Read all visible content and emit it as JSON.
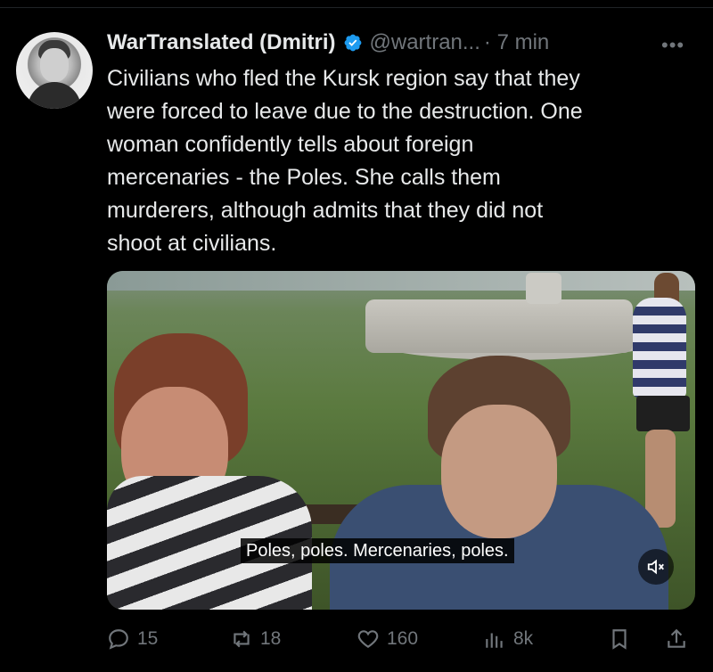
{
  "tweet": {
    "display_name": "WarTranslated (Dmitri)",
    "handle": "@wartran...",
    "time": "· 7 min",
    "more_label": "•••",
    "text": "Civilians who fled the Kursk region say that they\nwere forced to leave due to the destruction. One\nwoman confidently tells about foreign\nmercenaries - the Poles. She calls them\nmurderers, although admits that they did not\nshoot at civilians.",
    "media": {
      "subtitle": "Poles, poles. Mercenaries, poles.",
      "mute_icon": "speaker-muted-icon"
    },
    "actions": {
      "replies": "15",
      "reposts": "18",
      "likes": "160",
      "views": "8k"
    }
  },
  "colors": {
    "background": "#000000",
    "text": "#e7e9ea",
    "muted": "#71767b",
    "verified": "#1d9bf0"
  },
  "icons": [
    "reply-icon",
    "repost-icon",
    "like-icon",
    "views-icon",
    "bookmark-icon",
    "share-icon",
    "verified-badge-icon"
  ]
}
